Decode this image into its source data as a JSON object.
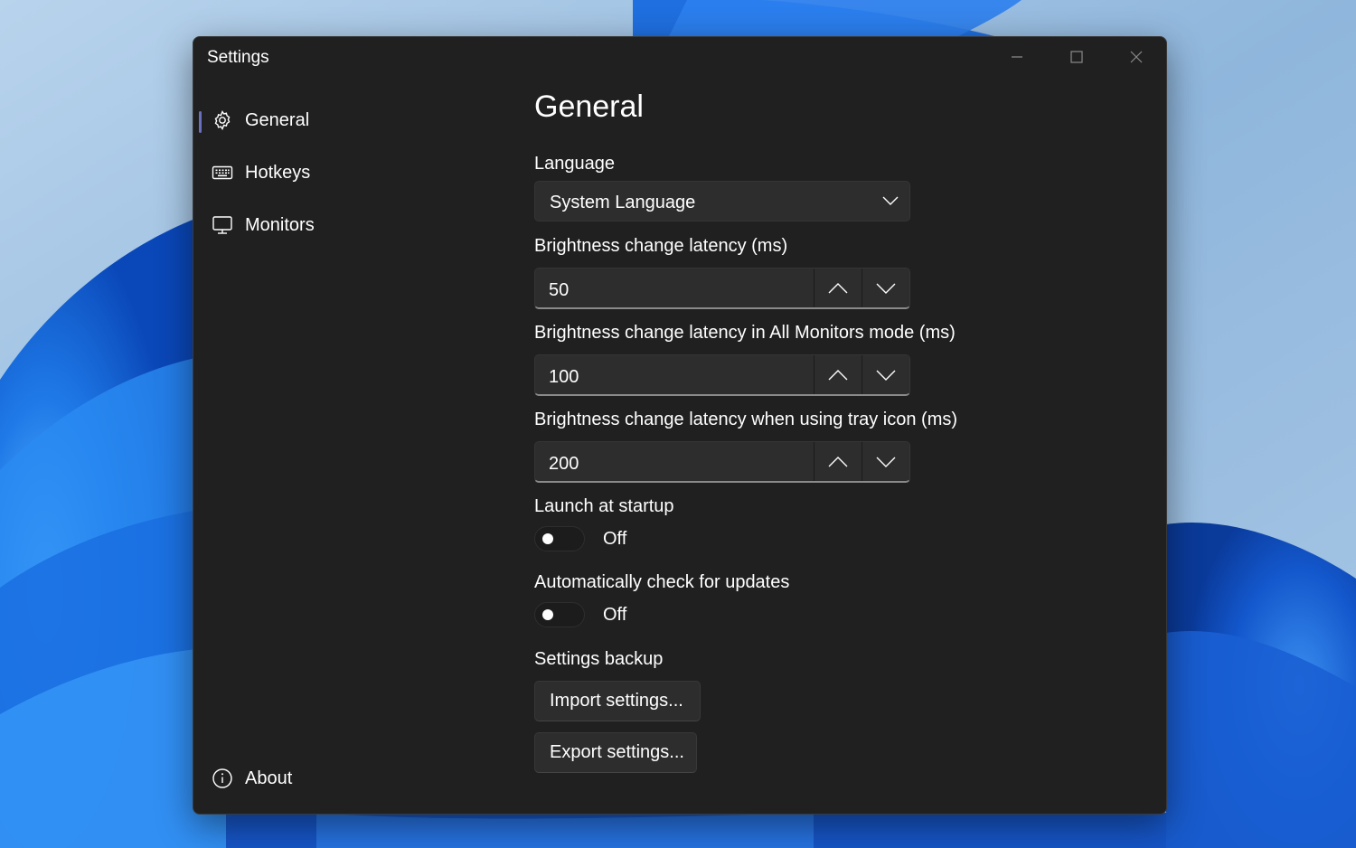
{
  "window": {
    "title": "Settings"
  },
  "caption_buttons": {
    "minimize_icon": "minimize-icon",
    "maximize_icon": "maximize-icon",
    "close_icon": "close-icon"
  },
  "sidebar": {
    "items": [
      {
        "label": "General",
        "icon": "gear-icon",
        "selected": true
      },
      {
        "label": "Hotkeys",
        "icon": "keyboard-icon",
        "selected": false
      },
      {
        "label": "Monitors",
        "icon": "monitor-icon",
        "selected": false
      }
    ],
    "footer_item": {
      "label": "About",
      "icon": "info-icon"
    }
  },
  "main": {
    "title": "General",
    "language": {
      "label": "Language",
      "value": "System Language"
    },
    "latency": {
      "label": "Brightness change latency (ms)",
      "value": "50"
    },
    "latency_all": {
      "label": "Brightness change latency in All Monitors mode (ms)",
      "value": "100"
    },
    "latency_tray": {
      "label": "Brightness change latency when using tray icon (ms)",
      "value": "200"
    },
    "launch_startup": {
      "label": "Launch at startup",
      "state": "Off"
    },
    "auto_update": {
      "label": "Automatically check for updates",
      "state": "Off"
    },
    "backup": {
      "label": "Settings backup",
      "import_label": "Import settings...",
      "export_label": "Export settings..."
    }
  },
  "colors": {
    "window_bg": "#202020",
    "control_bg": "#2d2d2d",
    "accent": "#6a6fbf",
    "wallpaper_blue": "#1f6fe0"
  }
}
